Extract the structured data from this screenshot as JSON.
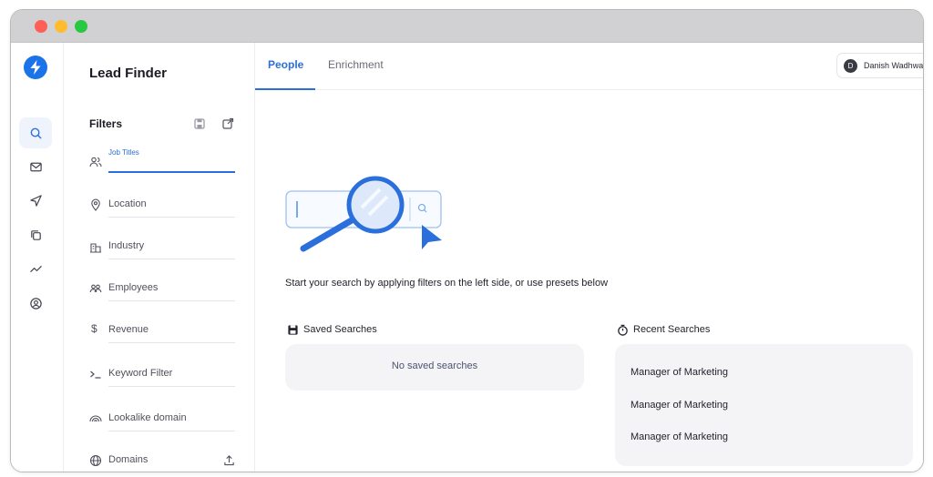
{
  "app": {
    "title": "Lead Finder"
  },
  "rail": {
    "items": [
      {
        "name": "search",
        "active": true
      },
      {
        "name": "mail",
        "active": false
      },
      {
        "name": "send",
        "active": false
      },
      {
        "name": "copy",
        "active": false
      },
      {
        "name": "analytics",
        "active": false
      },
      {
        "name": "account",
        "active": false
      }
    ]
  },
  "filters": {
    "title": "Filters",
    "items": [
      {
        "label": "Job Titles",
        "icon": "people-icon",
        "active": true
      },
      {
        "label": "Location",
        "icon": "location-pin-icon"
      },
      {
        "label": "Industry",
        "icon": "building-icon"
      },
      {
        "label": "Employees",
        "icon": "employees-icon"
      },
      {
        "label": "Revenue",
        "icon": "dollar-icon"
      },
      {
        "label": "Keyword Filter",
        "icon": "terminal-icon"
      },
      {
        "label": "Lookalike domain",
        "icon": "rainbow-icon"
      },
      {
        "label": "Domains",
        "icon": "globe-icon"
      }
    ]
  },
  "tabs": [
    {
      "label": "People",
      "active": true
    },
    {
      "label": "Enrichment",
      "active": false
    }
  ],
  "user": {
    "initial": "D",
    "name": "Danish Wadhwa"
  },
  "main": {
    "prompt": "Start your search by applying filters on the left side, or use presets below",
    "saved": {
      "title": "Saved Searches",
      "empty_text": "No saved searches"
    },
    "recent": {
      "title": "Recent Searches",
      "items": [
        "Manager of Marketing",
        "Manager of Marketing",
        "Manager of Marketing"
      ]
    }
  },
  "colors": {
    "accent": "#2a6fdb",
    "logo": "#1a73e8",
    "panel_bg": "#f4f4f6"
  }
}
